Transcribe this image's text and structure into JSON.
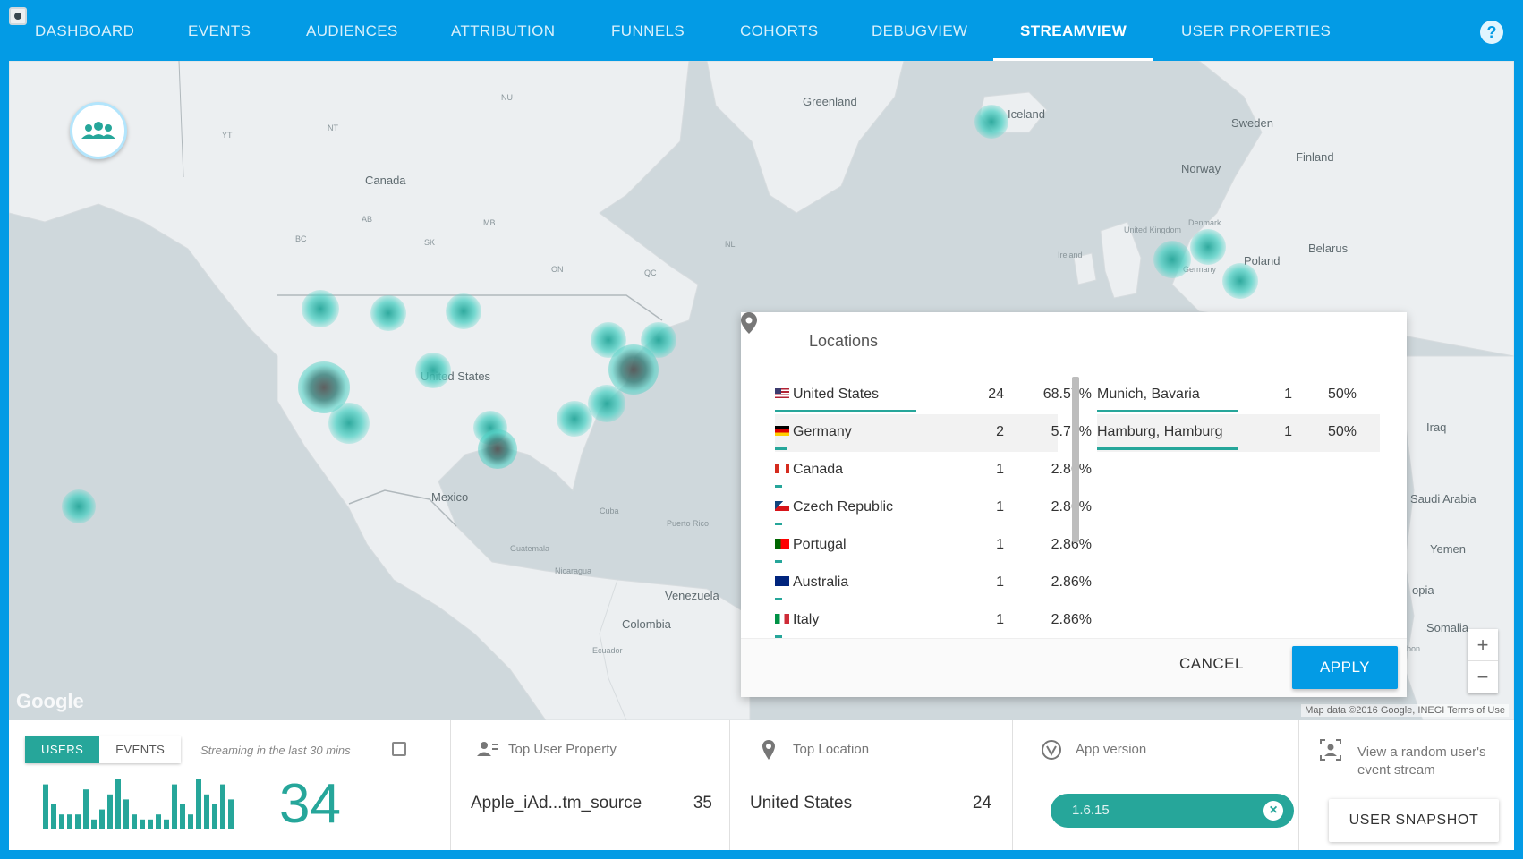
{
  "nav": {
    "items": [
      "DASHBOARD",
      "EVENTS",
      "AUDIENCES",
      "ATTRIBUTION",
      "FUNNELS",
      "COHORTS",
      "DEBUGVIEW",
      "STREAMVIEW",
      "USER PROPERTIES"
    ],
    "active": "STREAMVIEW",
    "help_icon": "?"
  },
  "map": {
    "labels": {
      "greenland": "Greenland",
      "iceland": "Iceland",
      "canada": "Canada",
      "united_states": "United States",
      "mexico": "Mexico",
      "cuba": "Cuba",
      "puerto_rico": "Puerto Rico",
      "guatemala": "Guatemala",
      "nicaragua": "Nicaragua",
      "venezuela": "Venezuela",
      "colombia": "Colombia",
      "ecuador": "Ecuador",
      "sweden": "Sweden",
      "finland": "Finland",
      "norway": "Norway",
      "denmark": "Denmark",
      "united_kingdom": "United Kingdom",
      "ireland": "Ireland",
      "poland": "Poland",
      "belarus": "Belarus",
      "germany": "Germany",
      "iraq": "Iraq",
      "saudi_arabia": "Saudi Arabia",
      "yemen": "Yemen",
      "somalia": "Somalia",
      "ethiopia": "opia",
      "gabon": "Gabon",
      "nu": "NU",
      "yt": "YT",
      "nt": "NT",
      "ab": "AB",
      "mb": "MB",
      "sk": "SK",
      "bc": "BC",
      "on": "ON",
      "qc": "QC",
      "nl": "NL"
    },
    "google": "Google",
    "credit": "Map data ©2016 Google, INEGI    Terms of Use",
    "zoom_in": "+",
    "zoom_out": "−"
  },
  "locations_panel": {
    "title": "Locations",
    "countries": [
      {
        "flag": "us",
        "name": "United States",
        "count": "24",
        "pct": "68.57%",
        "share": 0.6857
      },
      {
        "flag": "de",
        "name": "Germany",
        "count": "2",
        "pct": "5.71%",
        "share": 0.0571
      },
      {
        "flag": "ca",
        "name": "Canada",
        "count": "1",
        "pct": "2.86%",
        "share": 0.0286
      },
      {
        "flag": "cz",
        "name": "Czech Republic",
        "count": "1",
        "pct": "2.86%",
        "share": 0.0286
      },
      {
        "flag": "pt",
        "name": "Portugal",
        "count": "1",
        "pct": "2.86%",
        "share": 0.0286
      },
      {
        "flag": "au",
        "name": "Australia",
        "count": "1",
        "pct": "2.86%",
        "share": 0.0286
      },
      {
        "flag": "it",
        "name": "Italy",
        "count": "1",
        "pct": "2.86%",
        "share": 0.0286
      }
    ],
    "cities": [
      {
        "name": "Munich, Bavaria",
        "count": "1",
        "pct": "50%",
        "share": 0.5
      },
      {
        "name": "Hamburg, Hamburg",
        "count": "1",
        "pct": "50%",
        "share": 0.5
      }
    ],
    "cancel_label": "CANCEL",
    "apply_label": "APPLY"
  },
  "bottom": {
    "users_label": "USERS",
    "events_label": "EVENTS",
    "streaming_note": "Streaming in the last 30 mins",
    "user_count": "34",
    "spark_values": [
      0.9,
      0.5,
      0.3,
      0.3,
      0.3,
      0.8,
      0.2,
      0.4,
      0.7,
      1.0,
      0.6,
      0.3,
      0.2,
      0.2,
      0.3,
      0.2,
      0.9,
      0.5,
      0.3,
      1.0,
      0.7,
      0.5,
      0.9,
      0.6
    ],
    "top_user_property": {
      "title": "Top User Property",
      "value": "Apple_iAd...tm_source",
      "count": "35"
    },
    "top_location": {
      "title": "Top Location",
      "value": "United States",
      "count": "24"
    },
    "app_version": {
      "title": "App version",
      "chip": "1.6.15"
    },
    "random_user": {
      "text": "View a random user's event stream",
      "button": "USER SNAPSHOT"
    }
  },
  "colors": {
    "primary": "#039be5",
    "accent": "#26a69a",
    "map_bg": "#cfd8dc",
    "land": "#eceff1"
  }
}
